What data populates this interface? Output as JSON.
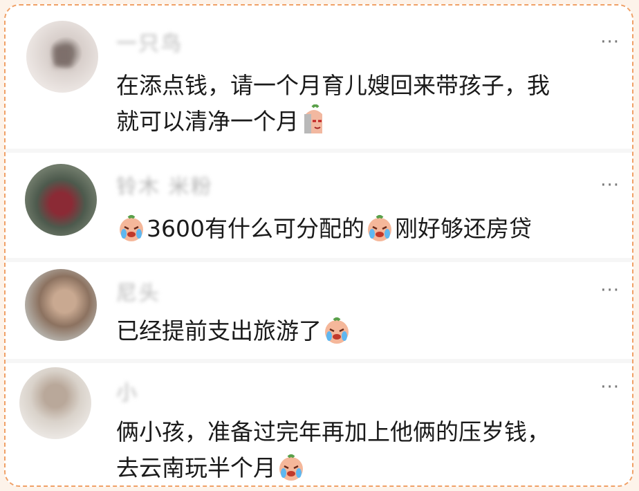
{
  "comments": [
    {
      "username": "一只鸟",
      "text_lines": [
        "在添点钱，请一个月育儿嫂回来带孩子，我",
        "就可以清净一个月"
      ],
      "more": "···"
    },
    {
      "username": "铃木 米粉",
      "text_parts": [
        "3600有什么可分配的",
        "刚好够还房贷"
      ],
      "more": "···"
    },
    {
      "username": "尼头",
      "text": "已经提前支出旅游了",
      "more": "···"
    },
    {
      "username": "小",
      "text_lines": [
        "俩小孩，准备过完年再加上他俩的压岁钱，",
        "去云南玩半个月"
      ],
      "more": "···"
    }
  ],
  "emojis": {
    "sly": "sly-face-emoji",
    "cry": "crying-face-emoji"
  },
  "colors": {
    "frame_border": "#f0a066",
    "text": "#1a1a1a"
  }
}
